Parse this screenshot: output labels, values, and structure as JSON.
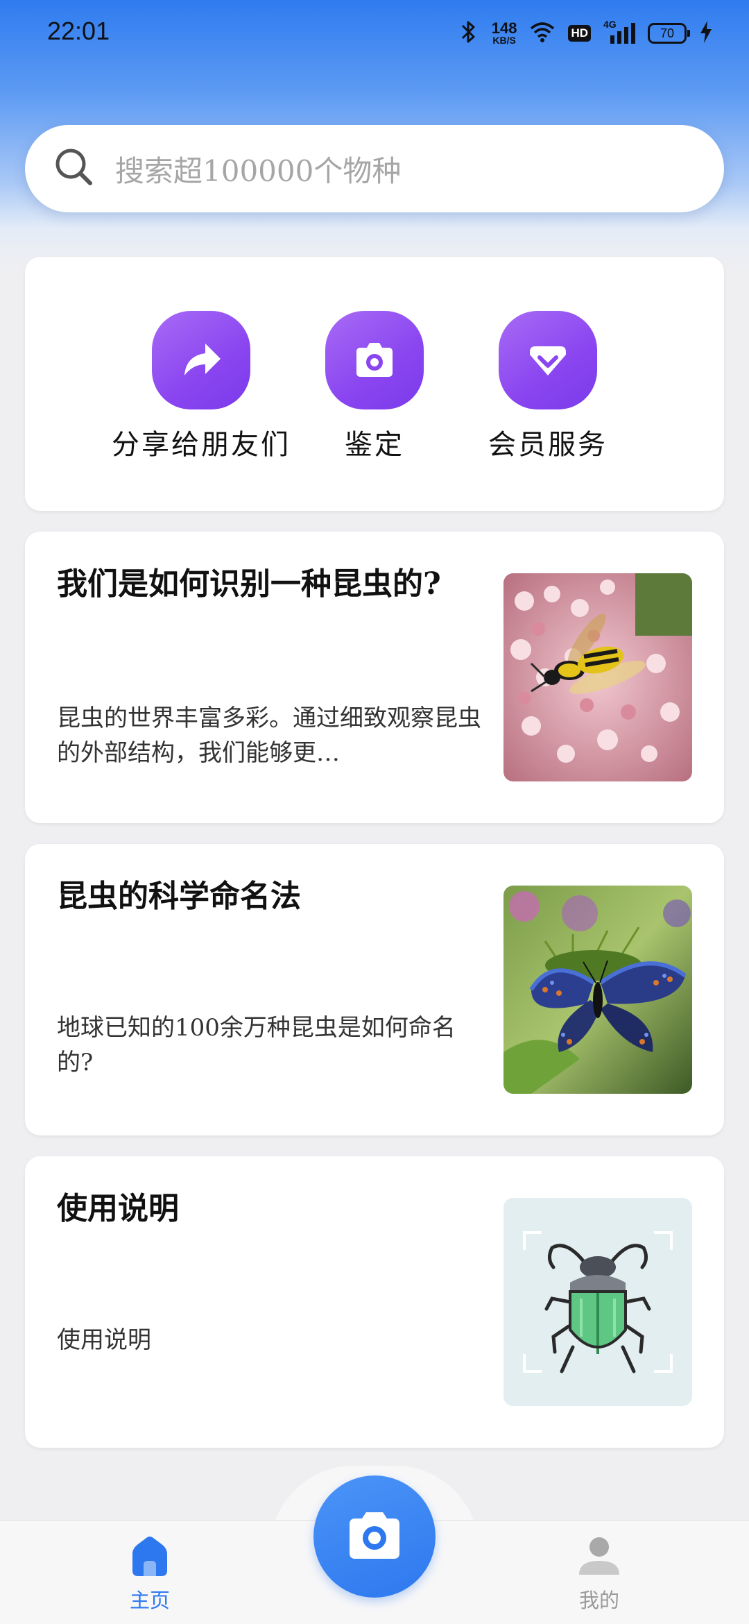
{
  "status_bar": {
    "time": "22:01",
    "net_speed": "148",
    "net_unit": "KB/S",
    "hd": "HD",
    "signal": "4G",
    "battery": "70",
    "icons": [
      "bluetooth-icon",
      "wifi-icon",
      "signal-icon",
      "charging-icon"
    ]
  },
  "search": {
    "placeholder": "搜索超100000个物种"
  },
  "quick_actions": [
    {
      "label": "分享给朋友们",
      "icon": "share-arrow-icon"
    },
    {
      "label": "鉴定",
      "icon": "camera-icon"
    },
    {
      "label": "会员服务",
      "icon": "vip-diamond-icon"
    }
  ],
  "articles": [
    {
      "title": "我们是如何识别一种昆虫的?",
      "summary": "昆虫的世界丰富多彩。通过细致观察昆虫的外部结构，我们能够更…",
      "image": "wasp-on-flowers-photo"
    },
    {
      "title": "昆虫的科学命名法",
      "summary": "地球已知的100余万种昆虫是如何命名的?",
      "image": "butterfly-on-thistle-photo"
    },
    {
      "title": "使用说明",
      "summary": "使用说明",
      "image": "beetle-scan-illustration"
    }
  ],
  "bottom_nav": {
    "home_label": "主页",
    "profile_label": "我的",
    "camera_icon": "camera-icon"
  },
  "colors": {
    "accent_blue": "#2d78ef",
    "accent_purple": "#8a45f0",
    "nav_inactive": "#9a9a9a"
  }
}
